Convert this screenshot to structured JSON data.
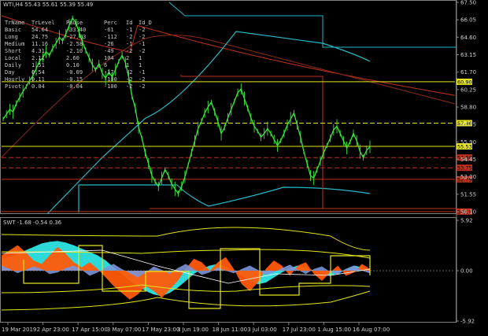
{
  "main_title": "WTI,H4  55.43 55.61 55.39 55.49",
  "sub_title": "SWT -1.68 -0.54 0.36",
  "colors": {
    "price": "#39e63a",
    "red": "#c0321e",
    "cyan": "#27b8c8",
    "yellow": "#e5e51c",
    "orange": "#ff5a0a",
    "aqua": "#2ee6e6",
    "blue": "#7a93d6",
    "white": "#ffffff"
  },
  "info_table": {
    "header": [
      "TrName",
      "TrLevel",
      "Pause",
      "Perc",
      "Id",
      "Id_D"
    ],
    "rows": [
      [
        "Basic",
        "54.64",
        "-33.40",
        "-61",
        "-1",
        "-2"
      ],
      [
        "Long",
        "24.75",
        "-27.63",
        "-112",
        "-2",
        "-2"
      ],
      [
        "Medium",
        "11.16",
        "-2.58",
        "-26",
        "-1",
        "-1"
      ],
      [
        "Short",
        "4.31",
        "-2.10",
        "-49",
        "-2",
        "-2"
      ],
      [
        "Local",
        "2.11",
        "2.60",
        "104",
        "2",
        "1"
      ],
      [
        "Daily",
        "1.51",
        "0.10",
        "6",
        "1",
        "1"
      ],
      [
        "Day",
        "0.54",
        "-0.09",
        "-17",
        "-2",
        "-1"
      ],
      [
        "Hourly",
        "0.11",
        "-0.15",
        "-100",
        "-2",
        "-2"
      ],
      [
        "Pivot",
        "0.04",
        "-0.04",
        "-100",
        "-2",
        "-2"
      ]
    ]
  },
  "chart_data": [
    {
      "type": "line",
      "title": "WTI,H4  55.43 55.61 55.39 55.49",
      "y_ticks": [
        "67.50",
        "66.05",
        "64.60",
        "63.15",
        "61.70",
        "60.25",
        "58.80",
        "57.35",
        "55.90",
        "54.45",
        "53.00",
        "51.55",
        "50.10"
      ],
      "ylim": [
        50.1,
        67.5
      ],
      "price_close": [
        57.8,
        58.2,
        58.6,
        58.4,
        59.1,
        59.6,
        60.1,
        60.5,
        61.0,
        61.4,
        62.0,
        62.6,
        62.9,
        63.4,
        63.1,
        63.7,
        64.1,
        64.6,
        64.3,
        64.9,
        65.6,
        66.2,
        65.8,
        65.0,
        64.2,
        63.5,
        62.9,
        62.3,
        61.9,
        62.4,
        61.6,
        61.2,
        61.7,
        61.3,
        61.9,
        62.6,
        63.1,
        62.5,
        61.3,
        59.7,
        58.7,
        57.1,
        56.2,
        55.0,
        54.1,
        53.1,
        52.6,
        52.2,
        52.9,
        53.6,
        53.1,
        52.4,
        52.0,
        51.6,
        52.2,
        53.0,
        54.0,
        55.0,
        56.0,
        57.0,
        57.6,
        58.3,
        58.8,
        59.2,
        58.4,
        57.6,
        56.6,
        57.1,
        57.9,
        58.6,
        59.3,
        60.0,
        60.3,
        59.5,
        58.7,
        57.9,
        57.2,
        56.8,
        56.3,
        56.6,
        57.0,
        56.6,
        56.1,
        55.6,
        56.0,
        56.6,
        57.3,
        57.8,
        58.3,
        57.3,
        56.3,
        55.1,
        54.1,
        53.1,
        52.9,
        53.6,
        54.3,
        55.0,
        55.6,
        56.2,
        56.9,
        57.2,
        56.6,
        56.0,
        55.4,
        55.9,
        56.6,
        56.0,
        55.1,
        54.6,
        55.2,
        55.49
      ],
      "levels": [
        {
          "label": "60.90",
          "value": 60.9,
          "color": "#e5e51c"
        },
        {
          "label": "57.46",
          "value": 57.46,
          "color": "#e5e51c"
        },
        {
          "label": "55.53",
          "value": 55.53,
          "color": "#e5e51c"
        },
        {
          "label": "54.60",
          "value": 54.6,
          "color": "#c0321e"
        },
        {
          "label": "53.75",
          "value": 53.75,
          "color": "#c0321e"
        },
        {
          "label": "52.79",
          "value": 52.79,
          "color": "#c0321e"
        },
        {
          "label": "50.11",
          "value": 50.11,
          "color": "#c0321e"
        }
      ]
    },
    {
      "type": "area",
      "title": "SWT -1.68 -0.54 0.36",
      "y_ticks": [
        "5.92",
        "0.00",
        "-5.92"
      ],
      "ylim": [
        -5.92,
        5.92
      ],
      "series": [
        {
          "values": [
            1.4,
            1.6,
            2.0,
            2.4,
            2.8,
            3.2,
            3.4,
            3.5,
            3.3,
            3.0,
            2.6,
            2.2,
            1.8,
            1.2,
            0.4,
            -0.4,
            -1.2,
            -1.8,
            -2.4,
            -2.8,
            -3.0,
            -2.6,
            -2.0,
            -1.2,
            -0.4,
            0.2,
            0.6,
            0.8,
            0.5,
            0.0,
            -0.6,
            -1.2,
            -1.6,
            -1.4,
            -0.8,
            -0.2,
            0.3,
            0.6,
            0.4,
            0.0,
            -0.3,
            -0.6,
            -0.3,
            0.2,
            0.6,
            0.4,
            0.1
          ]
        },
        {
          "values": [
            1.8,
            2.4,
            3.0,
            2.2,
            1.2,
            0.8,
            1.8,
            2.8,
            2.0,
            1.0,
            0.4,
            1.0,
            0.2,
            -0.8,
            -1.8,
            -2.6,
            -3.4,
            -2.8,
            -1.8,
            -2.4,
            -3.2,
            -2.2,
            -1.2,
            0.2,
            1.4,
            1.0,
            0.0,
            1.0,
            1.6,
            0.2,
            -1.6,
            -2.4,
            -1.4,
            0.2,
            1.2,
            0.6,
            -0.6,
            0.6,
            1.0,
            -0.4,
            -1.2,
            -0.2,
            0.6,
            -0.6,
            -0.2,
            0.8,
            0.2
          ]
        },
        {
          "values": [
            0.6,
            0.2,
            -0.3,
            0.1,
            0.5,
            0.2,
            -0.4,
            -0.2,
            0.3,
            0.6,
            0.1,
            -0.6,
            -0.2,
            0.4,
            0.8,
            0.2,
            -0.3,
            -0.8,
            -0.2,
            0.5,
            0.1,
            -0.4,
            0.3,
            0.8,
            0.2,
            -0.5,
            -0.2,
            0.4,
            0.0,
            -0.3,
            0.2,
            0.6,
            0.1,
            -0.5,
            -0.2,
            0.3,
            0.7,
            0.1,
            -0.4,
            0.2,
            0.5,
            -0.1,
            -0.5,
            0.2,
            0.6,
            0.0,
            -0.3
          ]
        }
      ]
    }
  ],
  "x_ticks": [
    "19 Mar 2019",
    "2 Apr 23:00",
    "17 Apr 15:00",
    "3 May 07:00",
    "17 May 23:00",
    "3 Jun 19:00",
    "18 Jun 11:00",
    "3 Jul 03:00",
    "17 Jul 23:00",
    "1 Aug 15:00",
    "16 Aug 07:00"
  ]
}
